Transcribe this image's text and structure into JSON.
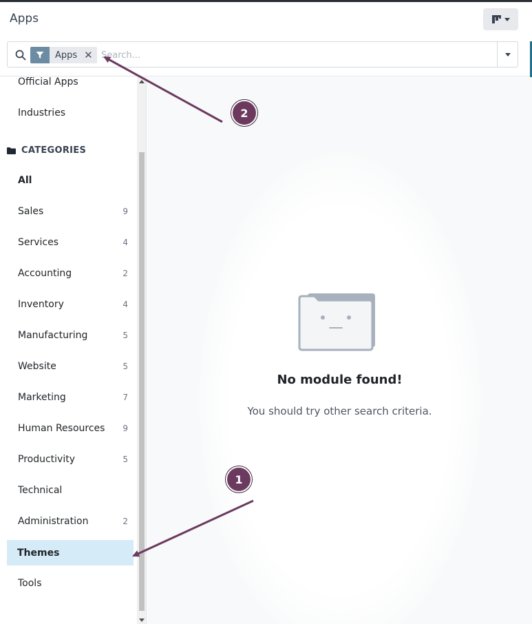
{
  "header": {
    "title": "Apps",
    "view_switcher_icon": "kanban-icon"
  },
  "search": {
    "facet_icon": "filter-icon",
    "facet_label": "Apps",
    "facet_remove": "✕",
    "placeholder": "Search..."
  },
  "sidebar": {
    "top_items": [
      {
        "label": "Official Apps"
      },
      {
        "label": "Industries"
      }
    ],
    "category_heading": "CATEGORIES",
    "categories": [
      {
        "label": "All",
        "count": ""
      },
      {
        "label": "Sales",
        "count": "9"
      },
      {
        "label": "Services",
        "count": "4"
      },
      {
        "label": "Accounting",
        "count": "2"
      },
      {
        "label": "Inventory",
        "count": "4"
      },
      {
        "label": "Manufacturing",
        "count": "5"
      },
      {
        "label": "Website",
        "count": "5"
      },
      {
        "label": "Marketing",
        "count": "7"
      },
      {
        "label": "Human Resources",
        "count": "9"
      },
      {
        "label": "Productivity",
        "count": "5"
      },
      {
        "label": "Technical",
        "count": ""
      },
      {
        "label": "Administration",
        "count": "2"
      },
      {
        "label": "Themes",
        "count": ""
      },
      {
        "label": "Tools",
        "count": ""
      }
    ],
    "active_category": "Themes"
  },
  "empty_state": {
    "title": "No module found!",
    "subtitle": "You should try other search criteria."
  },
  "annotations": [
    {
      "number": "1"
    },
    {
      "number": "2"
    }
  ],
  "colors": {
    "annotation": "#6b3a5e",
    "facet_icon_bg": "#6b8ca3",
    "active_item_bg": "#d5ebf8"
  }
}
